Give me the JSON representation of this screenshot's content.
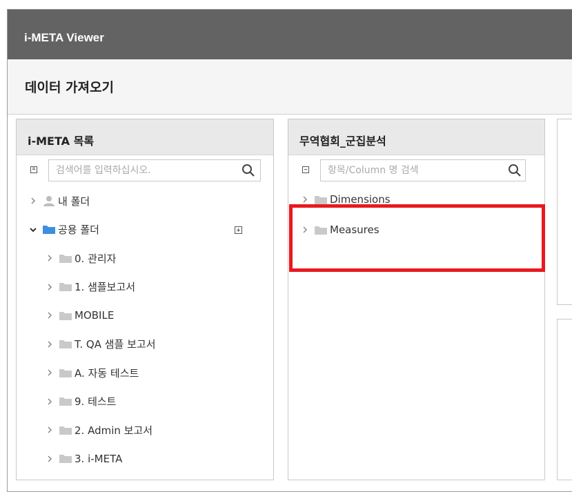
{
  "window": {
    "title": "i-META Viewer"
  },
  "subheader": {
    "title": "데이터 가져오기"
  },
  "left_panel": {
    "title": "i-META 목록",
    "search_placeholder": "검색어를 입력하십시오.",
    "tree": [
      {
        "label": "내 폴더",
        "icon": "person-icon",
        "expanded": false,
        "level": 0
      },
      {
        "label": "공용 폴더",
        "icon": "folder-icon-blue",
        "expanded": true,
        "level": 0
      },
      {
        "label": "0. 관리자",
        "icon": "folder-icon",
        "expanded": false,
        "level": 1
      },
      {
        "label": "1. 샘플보고서",
        "icon": "folder-icon",
        "expanded": false,
        "level": 1
      },
      {
        "label": "MOBILE",
        "icon": "folder-icon",
        "expanded": false,
        "level": 1
      },
      {
        "label": "T. QA 샘플 보고서",
        "icon": "folder-icon",
        "expanded": false,
        "level": 1
      },
      {
        "label": "A. 자동 테스트",
        "icon": "folder-icon",
        "expanded": false,
        "level": 1
      },
      {
        "label": "9. 테스트",
        "icon": "folder-icon",
        "expanded": false,
        "level": 1
      },
      {
        "label": "2. Admin 보고서",
        "icon": "folder-icon",
        "expanded": false,
        "level": 1
      },
      {
        "label": "3. i-META",
        "icon": "folder-icon",
        "expanded": false,
        "level": 1
      }
    ]
  },
  "middle_panel": {
    "title": "무역협회_군집분석",
    "search_placeholder": "항목/Column 명 검색",
    "tree": [
      {
        "label": "Dimensions",
        "icon": "folder-icon"
      },
      {
        "label": "Measures",
        "icon": "folder-icon"
      }
    ]
  },
  "colors": {
    "titlebar": "#636363",
    "highlight": "#e8191f",
    "folder_gray": "#c9c9c9",
    "folder_blue": "#3d8ee0"
  }
}
